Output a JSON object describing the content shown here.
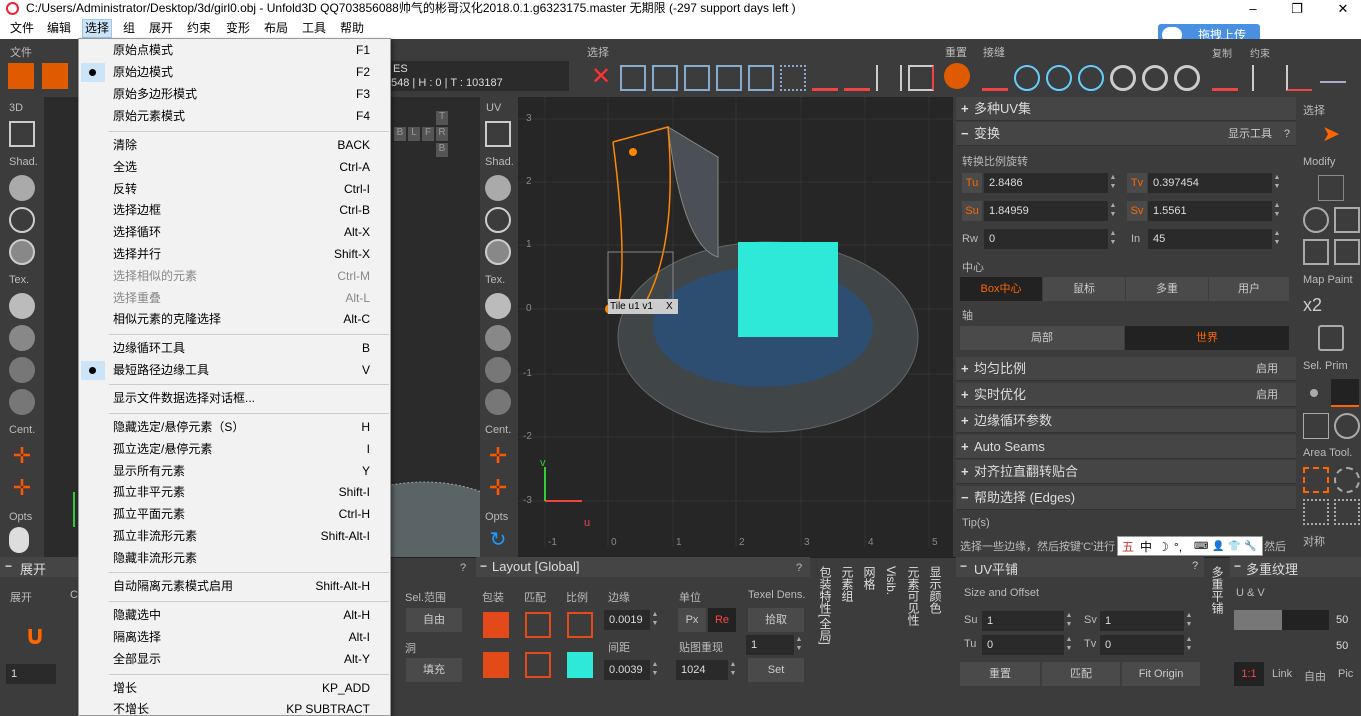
{
  "window": {
    "title": "C:/Users/Administrator/Desktop/3d/girl0.obj - Unfold3D QQ703856088帅气的彬哥汉化2018.0.1.g6323175.master 无期限 (-297 support days left )",
    "min": "–",
    "max": "❐",
    "close": "✕"
  },
  "menu": [
    "文件",
    "编辑",
    "选择",
    "组",
    "展开",
    "约束",
    "变形",
    "布局",
    "工具",
    "帮助"
  ],
  "upload_label": "拖拽上传",
  "toolbar": {
    "file_label": "文件",
    "select_label": "选择",
    "reset_label": "重置",
    "stitch_label": "接缝",
    "resample_label": "复制",
    "constraint_label": "约束",
    "mesh_info_ses": "ES",
    "mesh_info": "548 | H : 0 | T : 103187"
  },
  "left_sidebar": {
    "header": "3D",
    "shad": "Shad.",
    "tex": "Tex.",
    "cent": "Cent.",
    "opts": "Opts"
  },
  "uv_sidebar": {
    "header": "UV",
    "shad": "Shad.",
    "tex": "Tex.",
    "cent": "Cent.",
    "opts": "Opts"
  },
  "viewcube": [
    "B",
    "L",
    "F",
    "R",
    "T",
    "B"
  ],
  "uv_view": {
    "tile_label": "Tile u1 v1",
    "close": "X",
    "y_ticks": [
      "3",
      "2",
      "1",
      "0",
      "-1",
      "-2",
      "-3"
    ],
    "x_ticks": [
      "-1",
      "0",
      "1",
      "2",
      "3",
      "4",
      "5"
    ],
    "u_axis": "u",
    "v_axis": "v"
  },
  "right_panel": {
    "multi_uv": "多种UV集",
    "transform": "变换",
    "show_tools": "显示工具",
    "help_q": "?",
    "scale_rotate": "转换比例旋转",
    "tu": {
      "label": "Tu",
      "value": "2.8486"
    },
    "tv": {
      "label": "Tv",
      "value": "0.397454"
    },
    "su": {
      "label": "Su",
      "value": "1.84959"
    },
    "sv": {
      "label": "Sv",
      "value": "1.5561"
    },
    "rw": {
      "label": "Rw",
      "value": "0"
    },
    "in": {
      "label": "In",
      "value": "45"
    },
    "center": "中心",
    "center_opts": [
      "Box中心",
      "鼠标",
      "多重",
      "用户"
    ],
    "axis": "轴",
    "axis_opts": [
      "局部",
      "世界"
    ],
    "uniform": "均匀比例",
    "uniform_state": "启用",
    "realtime": "实时优化",
    "realtime_state": "启用",
    "edge_loop": "边缘循环参数",
    "auto_seams": "Auto Seams",
    "align": "对齐拉直翻转贴合",
    "help_select": "帮助选择 (Edges)",
    "tips": "Tip(s)",
    "tip_text": "选择一些边缘，然后按键'C'进行",
    "tip_tail": "然后"
  },
  "far_right": {
    "select": "选择",
    "modify": "Modify",
    "map_paint": "Map Paint",
    "x2": "x2",
    "sel_prim": "Sel. Prim",
    "area_tool": "Area Tool.",
    "pair": "对称"
  },
  "ime": [
    "五",
    "中",
    "☽",
    "°,",
    "⌨",
    "👤",
    "👕",
    "🔧"
  ],
  "bottom": {
    "unfold": "展开",
    "unfold_sub": "展开",
    "unfold_c": "C",
    "unfold_count": "1",
    "sel_range": "Sel.范围",
    "auto": "自由",
    "hole": "洞",
    "fill": "填充",
    "layout": "Layout [Global]",
    "pack": "包装",
    "match": "匹配",
    "ratio": "比例",
    "margin": "边缘",
    "margin_val": "0.0019",
    "spacing": "间距",
    "spacing_val": "0.0039",
    "unit": "单位",
    "px": "Px",
    "re": "Re",
    "tile_repeat": "贴图重现",
    "tile_val": "1024",
    "texel": "Texel Dens.",
    "pick": "拾取",
    "texel_val": "1",
    "set": "Set",
    "vtabs": [
      "包装特性[全局]",
      "元素组",
      "网格",
      "Visib.",
      "元素可见性",
      "显示颜色"
    ],
    "uv_tile": "UV平铺",
    "size_offset": "Size and Offset",
    "su": "Su",
    "su_val": "1",
    "sv": "Sv",
    "sv_val": "1",
    "tu": "Tu",
    "tu_val": "0",
    "tv": "Tv",
    "tv_val": "0",
    "reset": "重置",
    "match2": "匹配",
    "fit_origin": "Fit Origin",
    "multi_tile_tab": "多重平铺",
    "multi_tex": "多重纹理",
    "uv": "U & V",
    "v1": "50",
    "v2": "50",
    "ratio_11": "1:1",
    "link": "Link",
    "free": "自由",
    "pic": "Pic"
  },
  "dropdown": [
    {
      "label": "原始点模式",
      "shortcut": "F1",
      "dot": false,
      "dis": false
    },
    {
      "label": "原始边模式",
      "shortcut": "F2",
      "dot": true,
      "dis": false
    },
    {
      "label": "原始多边形模式",
      "shortcut": "F3",
      "dot": false,
      "dis": false
    },
    {
      "label": "原始元素模式",
      "shortcut": "F4",
      "dot": false,
      "dis": false
    },
    {
      "label": "清除",
      "shortcut": "BACK",
      "dot": false,
      "dis": false
    },
    {
      "label": "全选",
      "shortcut": "Ctrl-A",
      "dot": false,
      "dis": false
    },
    {
      "label": "反转",
      "shortcut": "Ctrl-I",
      "dot": false,
      "dis": false
    },
    {
      "label": "选择边框",
      "shortcut": "Ctrl-B",
      "dot": false,
      "dis": false
    },
    {
      "label": "选择循环",
      "shortcut": "Alt-X",
      "dot": false,
      "dis": false
    },
    {
      "label": "选择并行",
      "shortcut": "Shift-X",
      "dot": false,
      "dis": false
    },
    {
      "label": "选择相似的元素",
      "shortcut": "Ctrl-M",
      "dot": false,
      "dis": true
    },
    {
      "label": "选择重叠",
      "shortcut": "Alt-L",
      "dot": false,
      "dis": true
    },
    {
      "label": "相似元素的克隆选择",
      "shortcut": "Alt-C",
      "dot": false,
      "dis": false
    },
    {
      "label": "边缘循环工具",
      "shortcut": "B",
      "dot": false,
      "dis": false
    },
    {
      "label": "最短路径边缘工具",
      "shortcut": "V",
      "dot": true,
      "dis": false
    },
    {
      "label": "显示文件数据选择对话框...",
      "shortcut": "",
      "dot": false,
      "dis": false
    },
    {
      "label": "隐藏选定/悬停元素（S）",
      "shortcut": "H",
      "dot": false,
      "dis": false
    },
    {
      "label": "孤立选定/悬停元素",
      "shortcut": "I",
      "dot": false,
      "dis": false
    },
    {
      "label": "显示所有元素",
      "shortcut": "Y",
      "dot": false,
      "dis": false
    },
    {
      "label": "孤立非平元素",
      "shortcut": "Shift-I",
      "dot": false,
      "dis": false
    },
    {
      "label": "孤立平面元素",
      "shortcut": "Ctrl-H",
      "dot": false,
      "dis": false
    },
    {
      "label": "孤立非流形元素",
      "shortcut": "Shift-Alt-I",
      "dot": false,
      "dis": false
    },
    {
      "label": "隐藏非流形元素",
      "shortcut": "",
      "dot": false,
      "dis": false
    },
    {
      "label": "自动隔离元素模式启用",
      "shortcut": "Shift-Alt-H",
      "dot": false,
      "dis": false
    },
    {
      "label": "隐藏选中",
      "shortcut": "Alt-H",
      "dot": false,
      "dis": false
    },
    {
      "label": "隔离选择",
      "shortcut": "Alt-I",
      "dot": false,
      "dis": false
    },
    {
      "label": "全部显示",
      "shortcut": "Alt-Y",
      "dot": false,
      "dis": false
    },
    {
      "label": "增长",
      "shortcut": "KP_ADD",
      "dot": false,
      "dis": false
    },
    {
      "label": "不增长",
      "shortcut": "KP SUBTRACT",
      "dot": false,
      "dis": false
    }
  ]
}
